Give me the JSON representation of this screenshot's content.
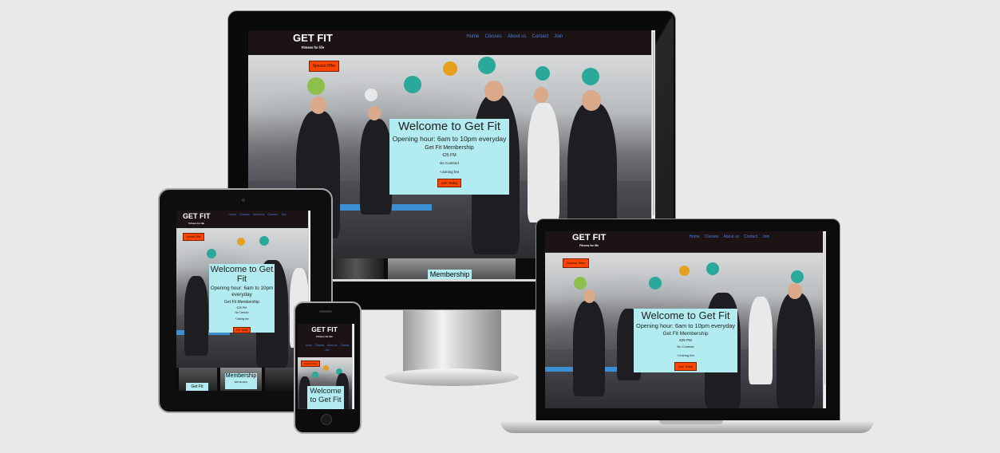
{
  "site": {
    "brand": "GET FIT",
    "tagline": "Fitness for life",
    "nav": [
      "Home",
      "Classes",
      "About us",
      "Contact",
      "Join"
    ],
    "promo": "Special Offer",
    "welcome": "Welcome to Get Fit",
    "hours": "Opening hour: 6am to 10pm everyday",
    "membership": "Get Fit Membership",
    "price": "€25 PM",
    "contract": "No Contract",
    "fee": "+Joining fee",
    "join_button": "Join Today"
  },
  "tablet_tail": {
    "card1": "Get Fit",
    "card2": "Membership",
    "card2_sub": "€25 Monthly"
  },
  "desktop_tail": {
    "membership_heading": "Membership"
  },
  "colors": {
    "nav_bg": "#1c1414",
    "link": "#4b7bd8",
    "accent": "#ff4500",
    "panel": "#b2ecf0"
  }
}
